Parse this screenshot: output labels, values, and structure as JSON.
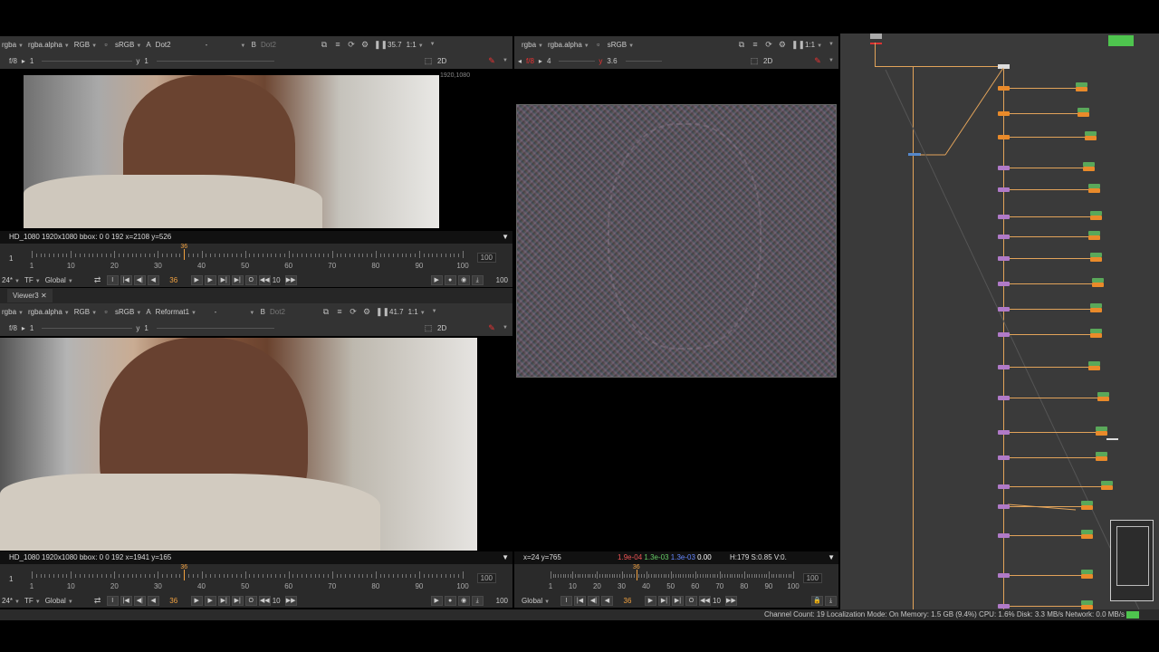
{
  "viewer_top_left": {
    "toolbar1": {
      "channels": "rgba",
      "layer": "rgba.alpha",
      "display": "RGB",
      "colorspace": "sRGB",
      "input_a_prefix": "A",
      "input_a": "Dot2",
      "dash": "-",
      "input_b_prefix": "B",
      "input_b": "Dot2",
      "zoom": "35.7",
      "ratio": "1:1"
    },
    "toolbar2": {
      "fstop": "f/8",
      "gain": "1",
      "gamma_label": "y",
      "gamma": "1",
      "mode": "2D"
    },
    "format_badge": "1920,1080",
    "info": "HD_1080 1920x1080  bbox: 0 0 192 x=2108 y=526",
    "timeline": {
      "start": "1",
      "end": "100",
      "ticks": [
        "1",
        "10",
        "20",
        "30",
        "40",
        "50",
        "60",
        "70",
        "80",
        "90",
        "100"
      ],
      "cursor_label": "36",
      "cursor_frame": 36
    },
    "playback": {
      "fps": "24*",
      "tf": "TF",
      "global": "Global",
      "frame": "36",
      "step": "10",
      "end": "100"
    }
  },
  "viewer_bottom_left": {
    "tab": "Viewer3",
    "toolbar1": {
      "channels": "rgba",
      "layer": "rgba.alpha",
      "display": "RGB",
      "colorspace": "sRGB",
      "input_a_prefix": "A",
      "input_a": "Reformat1",
      "dash": "-",
      "input_b_prefix": "B",
      "input_b": "Dot2",
      "zoom": "41.7",
      "ratio": "1:1"
    },
    "toolbar2": {
      "fstop": "f/8",
      "gain": "1",
      "gamma_label": "y",
      "gamma": "1",
      "mode": "2D"
    },
    "info": "HD_1080 1920x1080  bbox: 0 0 192 x=1941 y=165",
    "timeline": {
      "start": "1",
      "end": "100",
      "ticks": [
        "1",
        "10",
        "20",
        "30",
        "40",
        "50",
        "60",
        "70",
        "80",
        "90",
        "100"
      ],
      "cursor_label": "36",
      "cursor_frame": 36
    },
    "playback": {
      "fps": "24*",
      "tf": "TF",
      "global": "Global",
      "frame": "36",
      "step": "10",
      "end": "100"
    }
  },
  "viewer_right": {
    "toolbar1": {
      "channels": "rgba",
      "layer": "rgba.alpha",
      "colorspace": "sRGB",
      "ratio": "1:1"
    },
    "toolbar2": {
      "fstop": "f/8",
      "gain": "4",
      "gamma_label": "y",
      "gamma": "3.6",
      "mode": "2D"
    },
    "pixel_info": {
      "coords": "x=24 y=765",
      "r": "1.9e-04",
      "g": "1.3e-03",
      "b": "1.3e-03",
      "a": "0.00",
      "hsv": "H:179 S:0.85 V:0."
    },
    "timeline": {
      "start": "1",
      "end": "100",
      "ticks": [
        "1",
        "10",
        "20",
        "30",
        "40",
        "50",
        "60",
        "70",
        "80",
        "90",
        "100"
      ],
      "cursor_label": "36",
      "cursor_frame": 36
    },
    "playback": {
      "global": "Global",
      "frame": "36",
      "step": "10"
    }
  },
  "status_bar": "Channel Count: 19 Localization Mode: On Memory: 1.5 GB (9.4%) CPU: 1.6% Disk: 3.3 MB/s Network: 0.0 MB/s",
  "colors": {
    "accent": "#f0a040",
    "panel": "#333333",
    "node_orange": "#e98a2a",
    "node_purple": "#b07ac8",
    "node_green": "#5aa85a"
  }
}
